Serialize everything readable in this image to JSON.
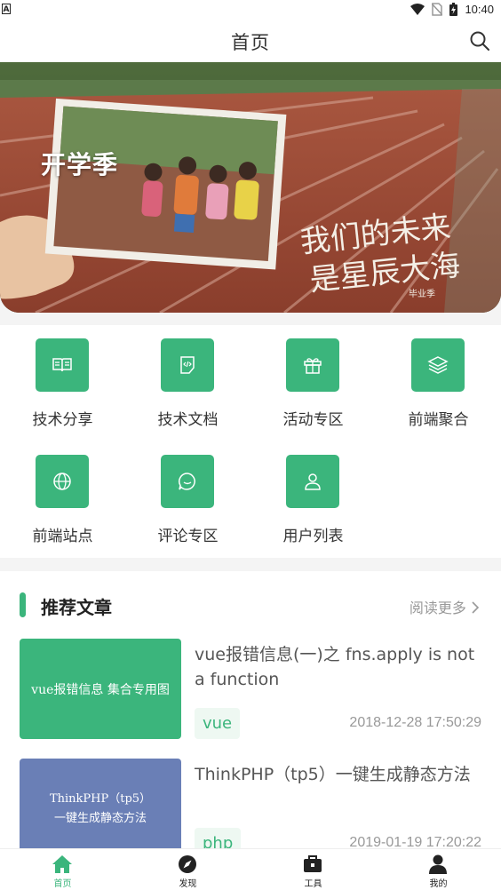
{
  "status_bar": {
    "time": "10:40",
    "left_badge": "A"
  },
  "header": {
    "title": "首页"
  },
  "banner": {
    "label": "开学季",
    "slogan_line1": "我们的未来",
    "slogan_line2": "是星辰大海",
    "slogan_sub": "毕业季"
  },
  "menu": [
    {
      "label": "技术分享",
      "icon": "book-icon"
    },
    {
      "label": "技术文档",
      "icon": "code-doc-icon"
    },
    {
      "label": "活动专区",
      "icon": "gift-icon"
    },
    {
      "label": "前端聚合",
      "icon": "layers-icon"
    },
    {
      "label": "前端站点",
      "icon": "globe-icon"
    },
    {
      "label": "评论专区",
      "icon": "chat-icon"
    },
    {
      "label": "用户列表",
      "icon": "user-icon"
    }
  ],
  "recommend": {
    "title": "推荐文章",
    "more": "阅读更多",
    "articles": [
      {
        "thumb_text": "vue报错信息 集合专用图",
        "thumb_color": "#3bb57c",
        "title": "vue报错信息(一)之 fns.apply is not a function",
        "tag": "vue",
        "date": "2018-12-28 17:50:29"
      },
      {
        "thumb_text_1": "ThinkPHP（tp5）",
        "thumb_text_2": "一键生成静态方法",
        "thumb_color": "#6a7fb6",
        "title": "ThinkPHP（tp5）一键生成静态方法",
        "tag": "php",
        "date": "2019-01-19 17:20:22"
      }
    ]
  },
  "tabbar": [
    {
      "label": "首页",
      "icon": "home-icon",
      "active": true
    },
    {
      "label": "发现",
      "icon": "compass-icon",
      "active": false
    },
    {
      "label": "工具",
      "icon": "toolbox-icon",
      "active": false
    },
    {
      "label": "我的",
      "icon": "person-icon",
      "active": false
    }
  ],
  "colors": {
    "accent": "#3bb57c",
    "page_bg": "#f4f4f4"
  }
}
